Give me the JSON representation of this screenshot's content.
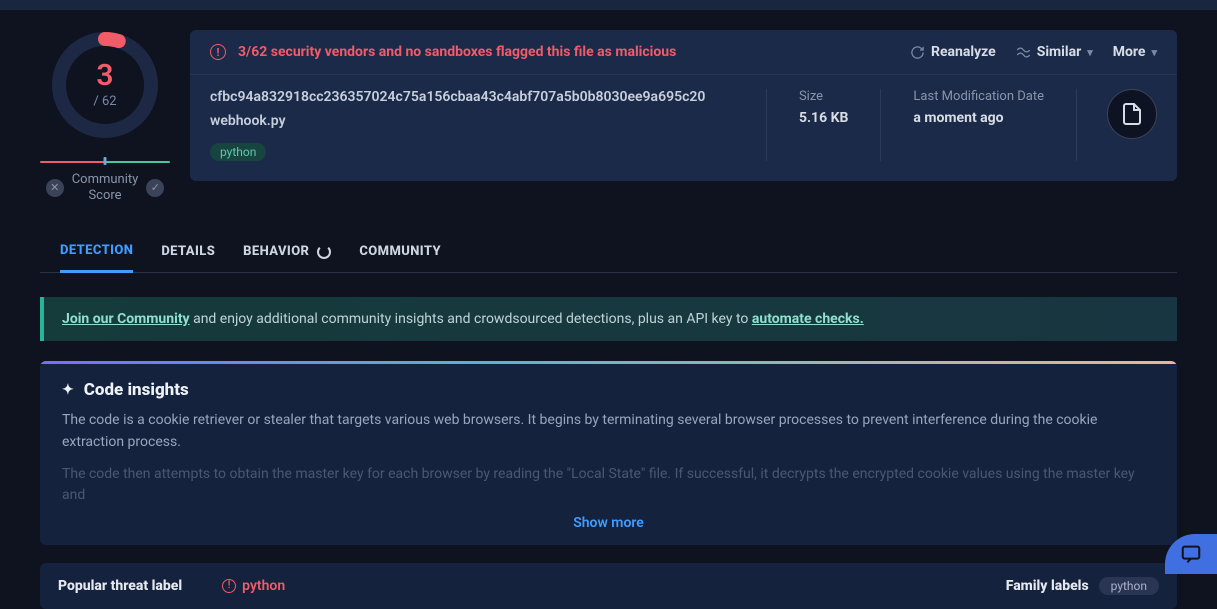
{
  "score": {
    "detections": "3",
    "total": "/ 62"
  },
  "community_score_label": "Community\nScore",
  "alert_text": "3/62 security vendors and no sandboxes flagged this file as malicious",
  "actions": {
    "reanalyze": "Reanalyze",
    "similar": "Similar",
    "more": "More"
  },
  "hash": "cfbc94a832918cc236357024c75a156cbaa43c4abf707a5b0b8030ee9a695c20",
  "filename": "webhook.py",
  "file_tag": "python",
  "size": {
    "label": "Size",
    "value": "5.16 KB"
  },
  "modified": {
    "label": "Last Modification Date",
    "value": "a moment ago"
  },
  "tabs": {
    "detection": "DETECTION",
    "details": "DETAILS",
    "behavior": "BEHAVIOR",
    "community": "COMMUNITY"
  },
  "banner": {
    "join": "Join our Community",
    "mid": " and enjoy additional community insights and crowdsourced detections, plus an API key to ",
    "automate": "automate checks."
  },
  "insights": {
    "title": "Code insights",
    "p1": "The code is a cookie retriever or stealer that targets various web browsers. It begins by terminating several browser processes to prevent interference during the cookie extraction process.",
    "p2": "The code then attempts to obtain the master key for each browser by reading the \"Local State\" file. If successful, it decrypts the encrypted cookie values using the master key and",
    "show_more": "Show more"
  },
  "threat": {
    "label": "Popular threat label",
    "value": "python"
  },
  "family": {
    "label": "Family labels",
    "value": "python"
  }
}
